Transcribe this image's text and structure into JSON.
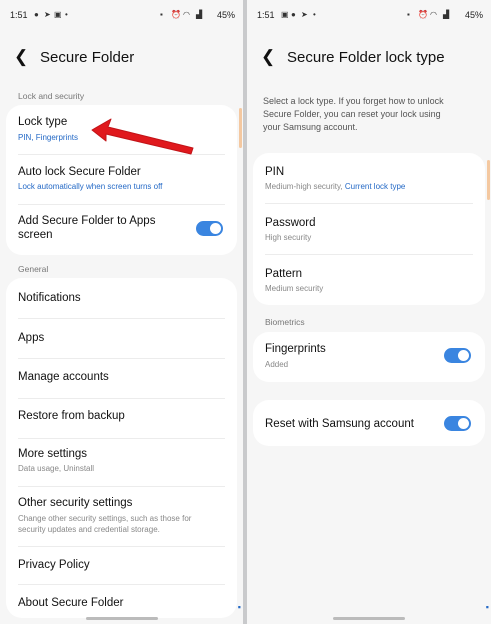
{
  "left": {
    "status": {
      "time": "1:51",
      "battery": "45%"
    },
    "title": "Secure Folder",
    "section_lock": "Lock and security",
    "lock_type": {
      "title": "Lock type",
      "sub": "PIN, Fingerprints"
    },
    "auto_lock": {
      "title": "Auto lock Secure Folder",
      "sub": "Lock automatically when screen turns off"
    },
    "add_apps": {
      "title_line1": "Add Secure Folder to Apps",
      "title_line2": "screen"
    },
    "section_general": "General",
    "notifications": "Notifications",
    "apps": "Apps",
    "manage_accounts": "Manage accounts",
    "restore": "Restore from backup",
    "more_settings": {
      "title": "More settings",
      "sub": "Data usage, Uninstall"
    },
    "other_security": {
      "title": "Other security settings",
      "sub1": "Change other security settings, such as those for",
      "sub2": "security updates and credential storage."
    },
    "privacy": "Privacy Policy",
    "about": "About Secure Folder"
  },
  "right": {
    "status": {
      "time": "1:51",
      "battery": "45%"
    },
    "title": "Secure Folder lock type",
    "desc_line1": "Select a lock type. If you forget how to unlock",
    "desc_line2": "Secure Folder, you can reset your lock using",
    "desc_line3": "your Samsung account.",
    "pin": {
      "title": "PIN",
      "sub_a": "Medium-high security, ",
      "sub_b": "Current lock type"
    },
    "password": {
      "title": "Password",
      "sub": "High security"
    },
    "pattern": {
      "title": "Pattern",
      "sub": "Medium security"
    },
    "section_biometrics": "Biometrics",
    "fingerprints": {
      "title": "Fingerprints",
      "sub": "Added"
    },
    "reset": "Reset with Samsung account"
  },
  "colors": {
    "accent": "#3a85e0",
    "arrow": "#e0191d",
    "link": "#2469c6"
  }
}
